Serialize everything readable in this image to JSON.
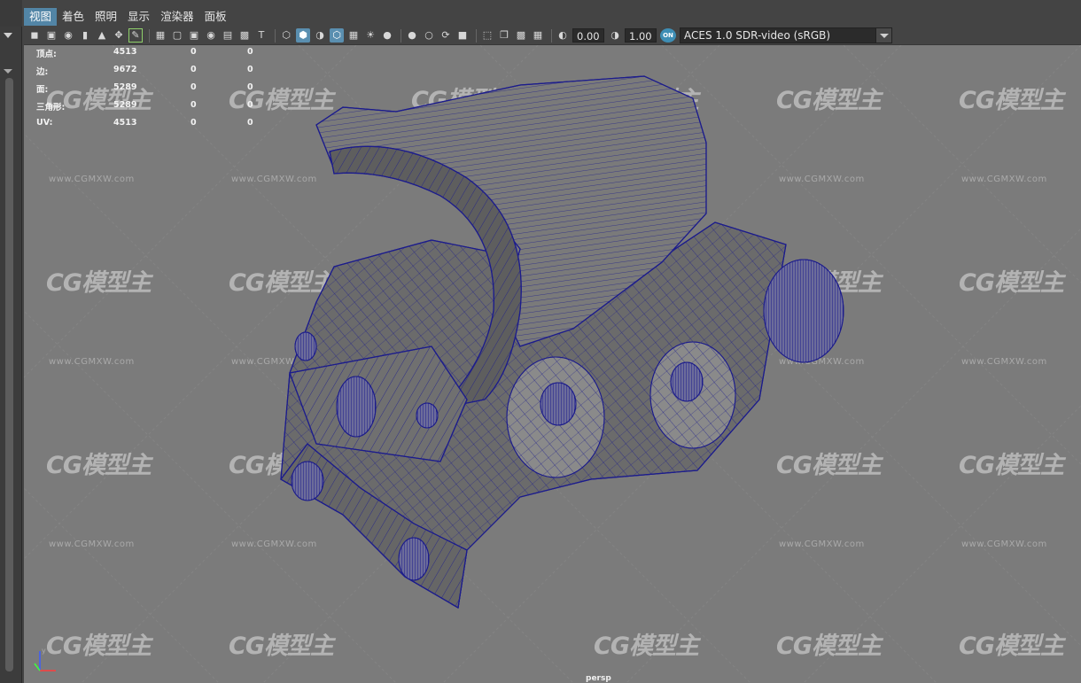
{
  "menu": {
    "items": [
      "视图",
      "着色",
      "照明",
      "显示",
      "渲染器",
      "面板"
    ]
  },
  "toolbar": {
    "gamma_value": "0.00",
    "exposure_value": "1.00",
    "color_mgmt_badge": "ON",
    "color_space": "ACES 1.0 SDR-video (sRGB)",
    "icons": [
      "camera-select-icon",
      "camera-attributes-icon",
      "bookmark-icon",
      "image-plane-icon",
      "2d-pan-zoom-icon",
      "grease-pencil-icon",
      "grid-icon",
      "film-gate-icon",
      "resolution-gate-icon",
      "gate-mask-icon",
      "field-chart-icon",
      "safe-action-icon",
      "safe-title-icon",
      "wireframe-icon",
      "smooth-shade-icon",
      "default-material-icon",
      "wireframe-on-shaded-icon",
      "xray-icon",
      "use-all-lights-icon",
      "shadows-icon",
      "screen-space-ao-icon",
      "motion-blur-icon",
      "multisample-aa-icon",
      "depth-of-field-icon",
      "isolate-select-icon",
      "xray-joints-icon",
      "xray-active-icon",
      "backface-culling-icon",
      "exposure-icon",
      "gamma-icon",
      "color-management-icon"
    ]
  },
  "hud": {
    "rows": [
      {
        "label": "顶点:",
        "v1": "4513",
        "v2": "0",
        "v3": "0"
      },
      {
        "label": "边:",
        "v1": "9672",
        "v2": "0",
        "v3": "0"
      },
      {
        "label": "面:",
        "v1": "5289",
        "v2": "0",
        "v3": "0"
      },
      {
        "label": "三角形:",
        "v1": "5289",
        "v2": "0",
        "v3": "0"
      },
      {
        "label": "UV:",
        "v1": "4513",
        "v2": "0",
        "v3": "0"
      }
    ]
  },
  "viewport": {
    "camera_label": "persp",
    "background_color": "#7b7b7b",
    "wire_color": "#1c1c8c"
  },
  "watermark": {
    "logo": "CG模型主",
    "url": "www.CGMXW.com"
  },
  "axes": {
    "x": "x",
    "y": "y",
    "z": "z"
  }
}
